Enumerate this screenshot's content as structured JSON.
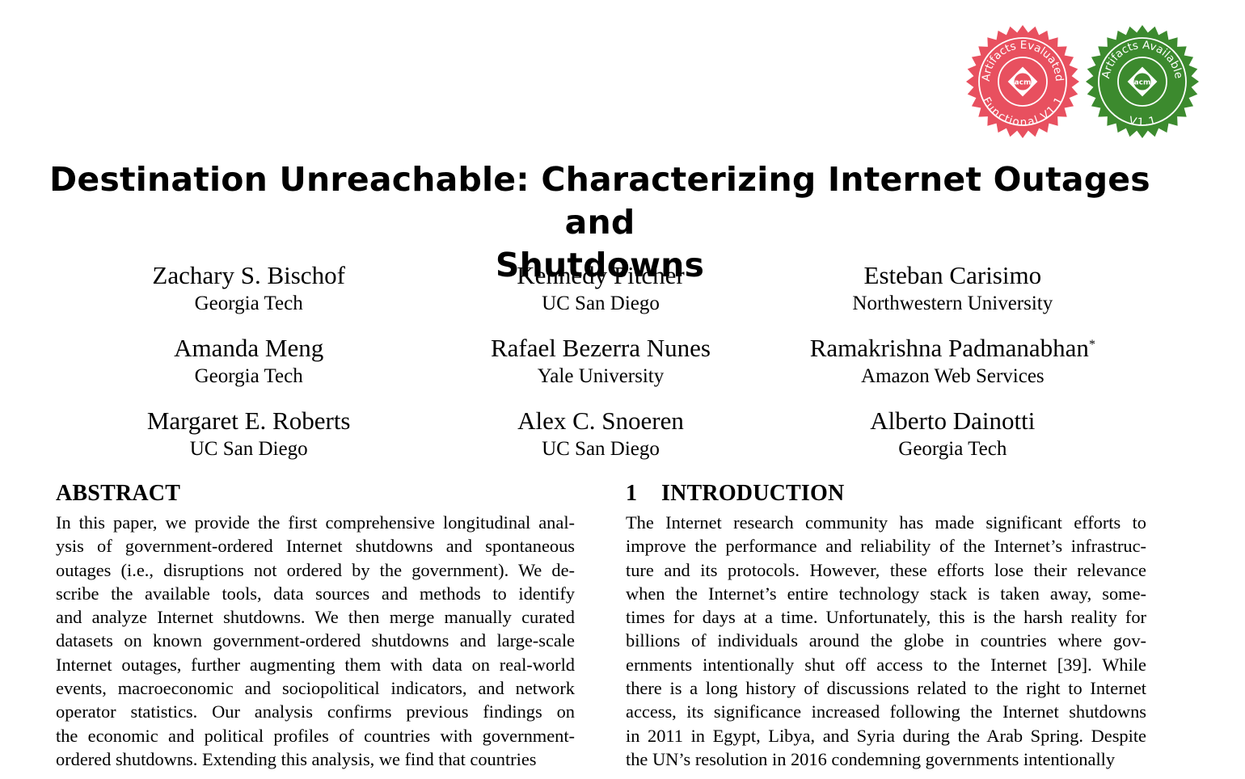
{
  "badges": [
    {
      "top_text": "Artifacts Evaluated",
      "bottom_text": "Functional V1.1",
      "logo": "acm",
      "color": "#e8505f"
    },
    {
      "top_text": "Artifacts Available",
      "bottom_text": "V1.1",
      "logo": "acm",
      "color": "#3c8a2e"
    }
  ],
  "paper": {
    "title_line1": "Destination Unreachable: Characterizing Internet Outages and",
    "title_line2": "Shutdowns"
  },
  "authors": [
    {
      "name": "Zachary S. Bischof",
      "affiliation": "Georgia Tech"
    },
    {
      "name": "Kennedy Pitcher",
      "affiliation": "UC San Diego"
    },
    {
      "name": "Esteban Carisimo",
      "affiliation": "Northwestern University"
    },
    {
      "name": "Amanda Meng",
      "affiliation": "Georgia Tech"
    },
    {
      "name": "Rafael Bezerra Nunes",
      "affiliation": "Yale University"
    },
    {
      "name": "Ramakrishna Padmanabhan",
      "mark": "*",
      "affiliation": "Amazon Web Services"
    },
    {
      "name": "Margaret E. Roberts",
      "affiliation": "UC San Diego"
    },
    {
      "name": "Alex C. Snoeren",
      "affiliation": "UC San Diego"
    },
    {
      "name": "Alberto Dainotti",
      "affiliation": "Georgia Tech"
    }
  ],
  "abstract": {
    "heading": "Abstract",
    "lines": [
      "In this paper, we provide the first comprehensive longitudinal anal-",
      "ysis of government-ordered Internet shutdowns and spontaneous",
      "outages (i.e., disruptions not ordered by the government). We de-",
      "scribe the available tools, data sources and methods to identify",
      "and analyze Internet shutdowns. We then merge manually curated",
      "datasets on known government-ordered shutdowns and large-scale",
      "Internet outages, further augmenting them with data on real-world",
      "events, macroeconomic and sociopolitical indicators, and network",
      "operator statistics. Our analysis confirms previous findings on",
      "the economic and political profiles of countries with government-",
      "ordered shutdowns. Extending this analysis, we find that countries"
    ]
  },
  "introduction": {
    "number": "1",
    "heading": "Introduction",
    "lines": [
      "The Internet research community has made significant efforts to",
      "improve the performance and reliability of the Internet’s infrastruc-",
      "ture and its protocols. However, these efforts lose their relevance",
      "when the Internet’s entire technology stack is taken away, some-",
      "times for days at a time. Unfortunately, this is the harsh reality for",
      "billions of individuals around the globe in countries where gov-",
      "ernments intentionally shut off access to the Internet [39]. While",
      "there is a long history of discussions related to the right to Internet",
      "access, its significance increased following the Internet shutdowns",
      "in 2011 in Egypt, Libya, and Syria during the Arab Spring. Despite",
      "the UN’s resolution in 2016 condemning governments intentionally"
    ]
  }
}
